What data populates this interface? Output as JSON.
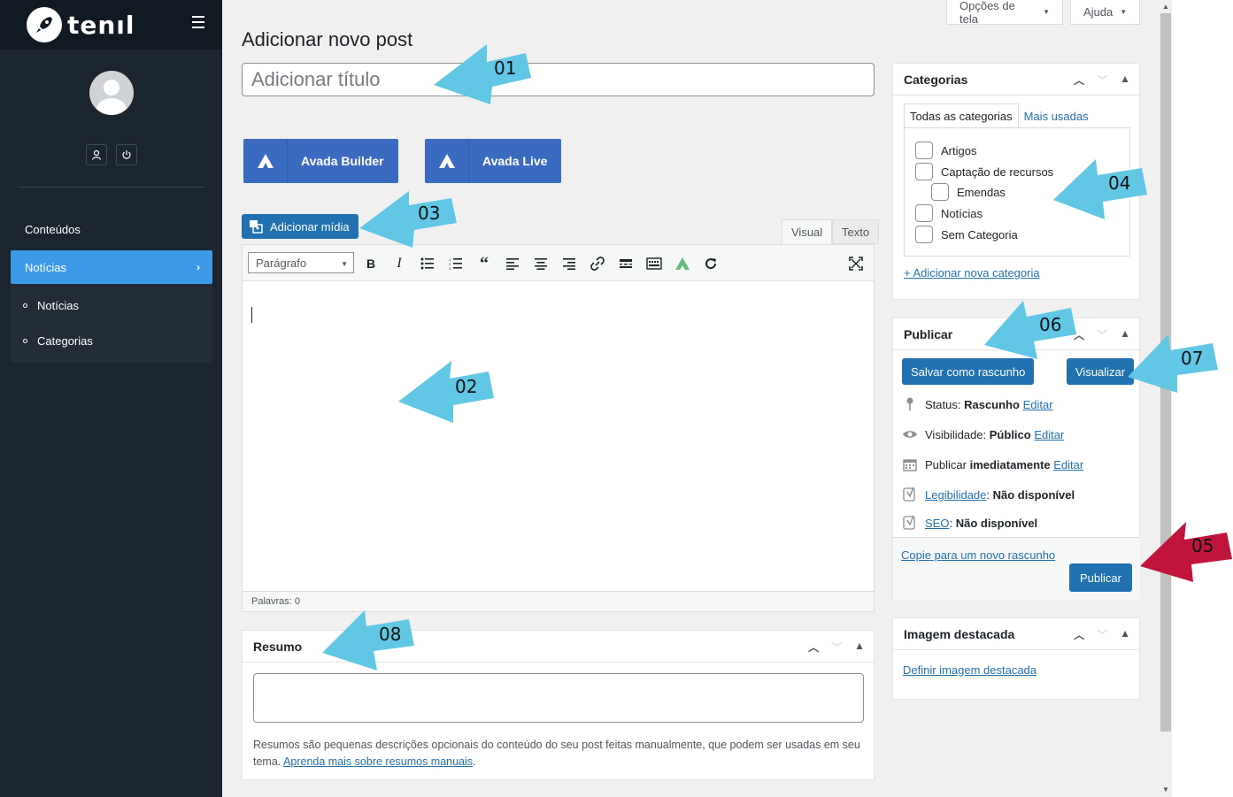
{
  "sidebar": {
    "brand": "tenıl",
    "menu_heading": "Conteúdos",
    "active_item": "Notícias",
    "subitems": [
      "Notícias",
      "Categorias"
    ]
  },
  "header": {
    "screen_options": "Opções de tela",
    "help": "Ajuda"
  },
  "page_title": "Adicionar novo post",
  "title_placeholder": "Adicionar título",
  "avada": {
    "builder": "Avada Builder",
    "live": "Avada Live"
  },
  "editor": {
    "add_media": "Adicionar mídia",
    "tab_visual": "Visual",
    "tab_text": "Texto",
    "format_select": "Parágrafo",
    "word_count": "Palavras: 0"
  },
  "summary": {
    "title": "Resumo",
    "help_text": "Resumos são pequenas descrições opcionais do conteúdo do seu post feitas manualmente, que podem ser usadas em seu tema.",
    "help_link": "Aprenda mais sobre resumos manuais"
  },
  "categories": {
    "title": "Categorias",
    "tab_all": "Todas as categorias",
    "tab_most_used": "Mais usadas",
    "items": [
      "Artigos",
      "Captação de recursos",
      "Emendas",
      "Notícias",
      "Sem Categoria"
    ],
    "add_new": "+ Adicionar nova categoria"
  },
  "publish": {
    "title": "Publicar",
    "save_draft": "Salvar como rascunho",
    "preview": "Visualizar",
    "status_label": "Status:",
    "status_value": "Rascunho",
    "visibility_label": "Visibilidade:",
    "visibility_value": "Público",
    "publish_label": "Publicar",
    "publish_value": "imediatamente",
    "edit": "Editar",
    "readability_link": "Legibilidade",
    "readability_value": "Não disponível",
    "seo_link": "SEO",
    "seo_value": "Não disponível",
    "copy_draft": "Copie para um novo rascunho",
    "publish_button": "Publicar"
  },
  "featured_image": {
    "title": "Imagem destacada",
    "set_link": "Definir imagem destacada"
  },
  "annotations": {
    "a01": "01",
    "a02": "02",
    "a03": "03",
    "a04": "04",
    "a05": "05",
    "a06": "06",
    "a07": "07",
    "a08": "08",
    "arrow_color": "#62c7e4",
    "arrow_highlight_color": "#c0143c"
  },
  "colors": {
    "sidebar_bg": "#1b2530",
    "active_menu": "#3d9ae8",
    "primary_button": "#2271b1",
    "avada_button": "#3b6bc1"
  }
}
